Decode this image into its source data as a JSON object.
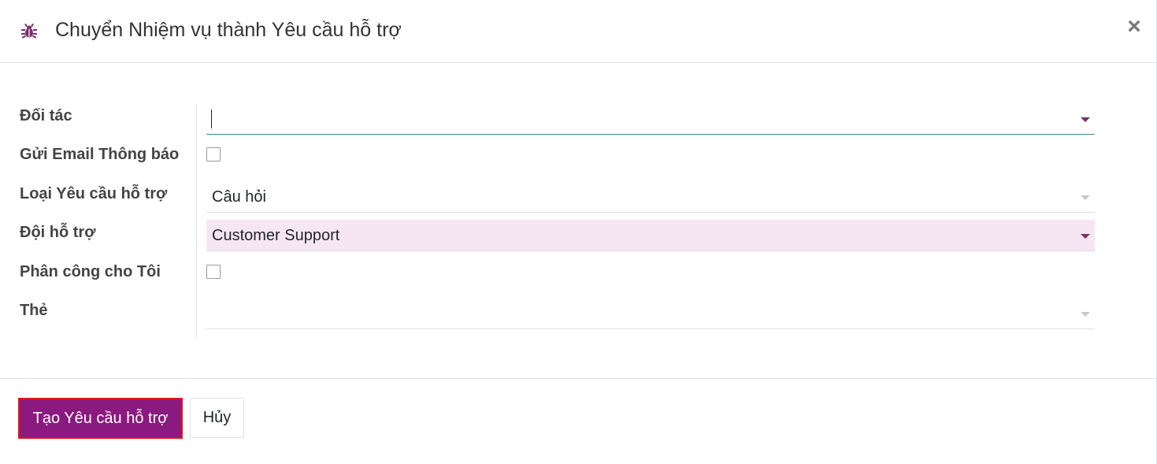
{
  "dialog": {
    "title": "Chuyển Nhiệm vụ thành Yêu cầu hỗ trợ",
    "icon": "bug-icon",
    "close_symbol": "×"
  },
  "form": {
    "partner": {
      "label": "Đối tác",
      "value": ""
    },
    "send_email": {
      "label": "Gửi Email Thông báo",
      "checked": false
    },
    "ticket_type": {
      "label": "Loại Yêu cầu hỗ trợ",
      "value": "Câu hỏi"
    },
    "team": {
      "label": "Đội hỗ trợ",
      "value": "Customer Support"
    },
    "assign_to_me": {
      "label": "Phân công cho Tôi",
      "checked": false
    },
    "tags": {
      "label": "Thẻ",
      "value": ""
    }
  },
  "footer": {
    "create_label": "Tạo Yêu cầu hỗ trợ",
    "cancel_label": "Hủy"
  },
  "colors": {
    "brand": "#8a1a7f",
    "highlight_bg": "#f6e6f3",
    "focus_border": "#3b8a9a",
    "button_outline": "#e0161f"
  }
}
